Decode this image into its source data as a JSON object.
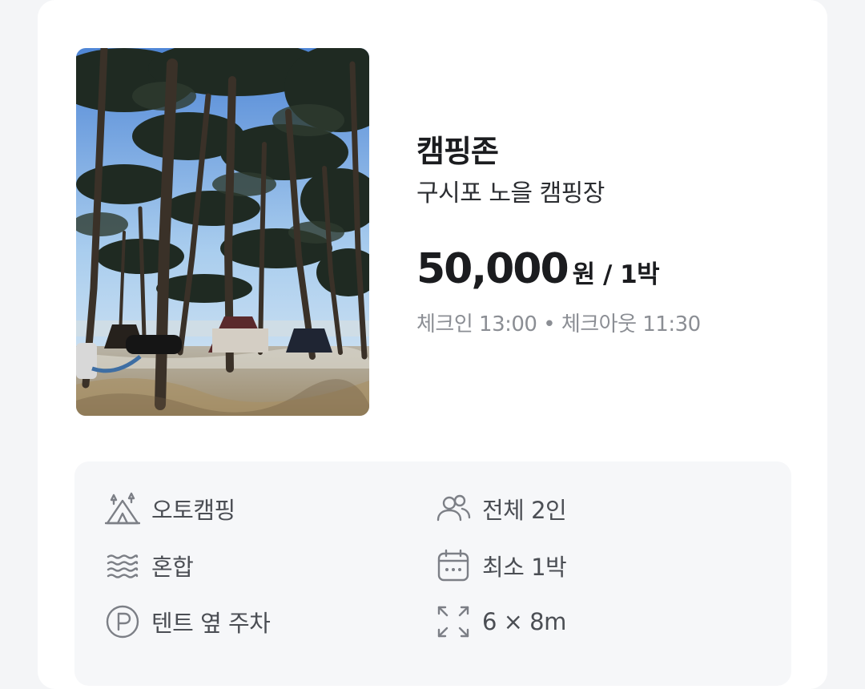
{
  "listing": {
    "category": "캠핑존",
    "site_name": "구시포 노을 캠핑장",
    "price": "50,000",
    "price_unit": "원 / 1박",
    "checkin_checkout": "체크인 13:00 • 체크아웃 11:30"
  },
  "features": [
    {
      "icon": "tent-icon",
      "label": "오토캠핑"
    },
    {
      "icon": "people-icon",
      "label": "전체 2인"
    },
    {
      "icon": "waves-icon",
      "label": "혼합"
    },
    {
      "icon": "calendar-icon",
      "label": "최소 1박"
    },
    {
      "icon": "parking-icon",
      "label": "텐트 옆 주차"
    },
    {
      "icon": "expand-icon",
      "label": "6 × 8m"
    }
  ],
  "colors": {
    "card_bg": "#ffffff",
    "page_bg": "#f4f5f7",
    "info_bg": "#f6f7f9",
    "icon": "#7c7f86",
    "muted_text": "#8b8e94"
  }
}
